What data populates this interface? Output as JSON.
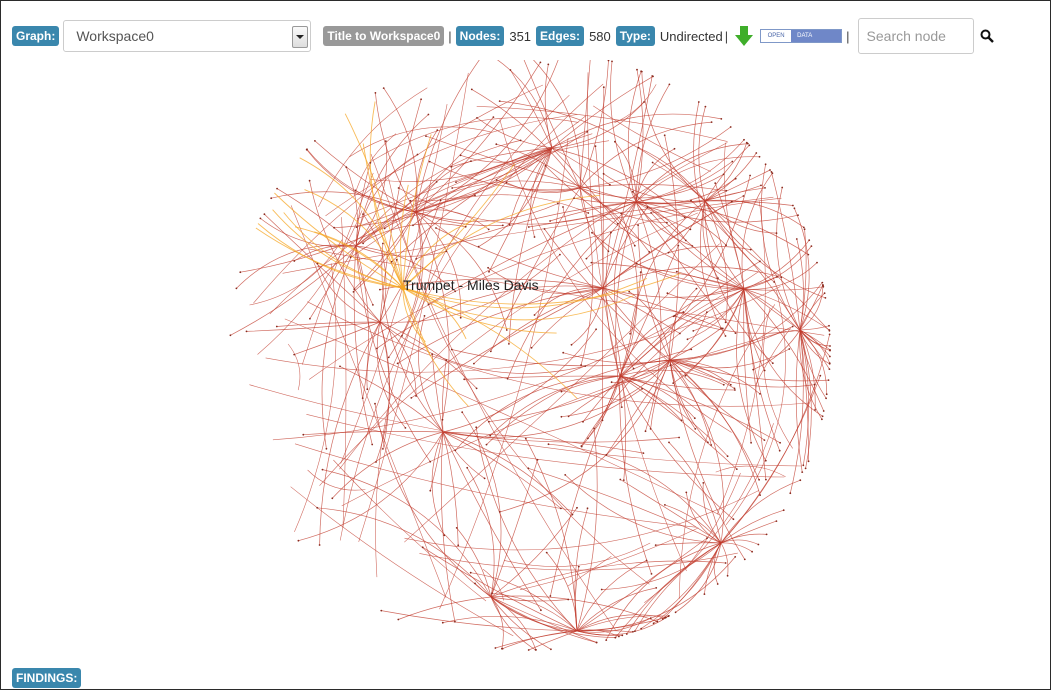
{
  "toolbar": {
    "graph_label": "Graph:",
    "workspace_value": "Workspace0",
    "title_button": "Title to Workspace0",
    "separator": "|",
    "nodes_label": "Nodes:",
    "nodes_count": "351",
    "edges_label": "Edges:",
    "edges_count": "580",
    "type_label": "Type:",
    "type_value": "Undirected",
    "open_data_left": "OPEN",
    "open_data_right": "DATA",
    "search_placeholder": "Search node"
  },
  "graph": {
    "highlighted_node": "Trumpet - Miles Davis"
  },
  "footer": {
    "findings_label": "FINDINGS:"
  },
  "colors": {
    "badge": "#3a87ad",
    "badge_gray": "#999999",
    "edge": "#c0392b",
    "highlight_edge": "#f5a623"
  }
}
